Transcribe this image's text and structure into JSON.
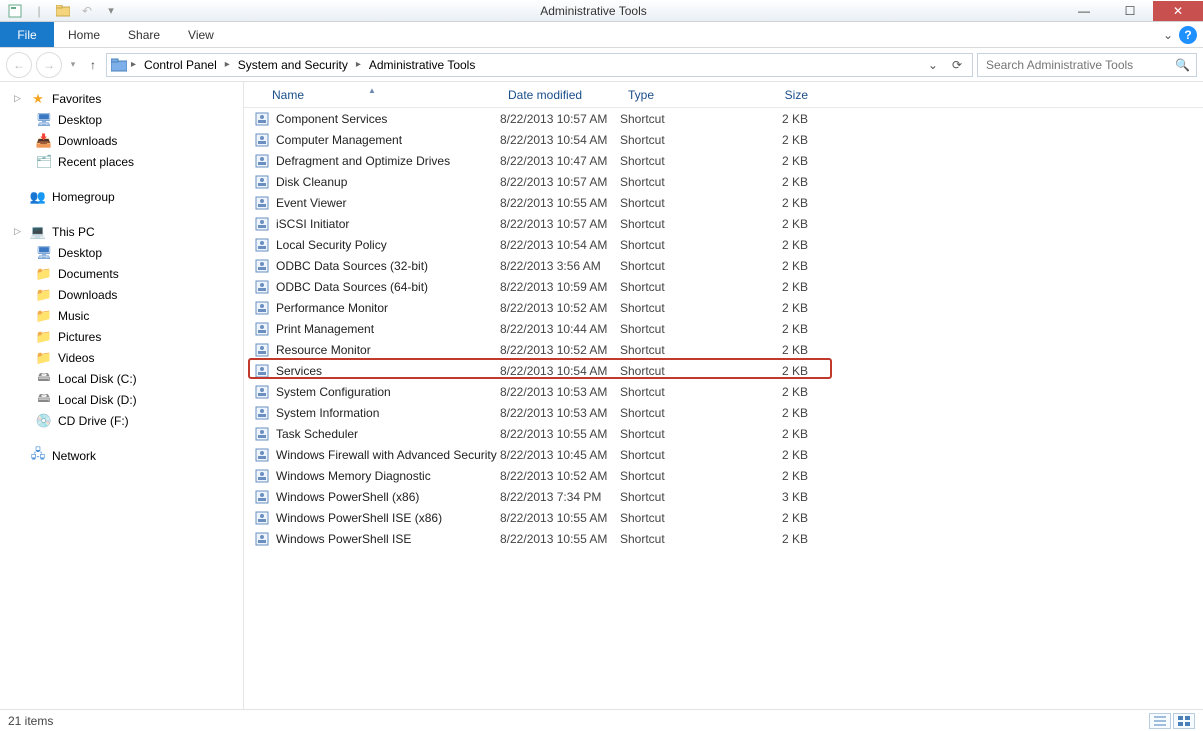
{
  "window": {
    "title": "Administrative Tools"
  },
  "ribbon": {
    "file": "File",
    "tabs": [
      "Home",
      "Share",
      "View"
    ]
  },
  "breadcrumb": [
    "Control Panel",
    "System and Security",
    "Administrative Tools"
  ],
  "search": {
    "placeholder": "Search Administrative Tools"
  },
  "sidebar": {
    "favorites": {
      "label": "Favorites",
      "items": [
        "Desktop",
        "Downloads",
        "Recent places"
      ]
    },
    "homegroup": {
      "label": "Homegroup"
    },
    "thispc": {
      "label": "This PC",
      "items": [
        "Desktop",
        "Documents",
        "Downloads",
        "Music",
        "Pictures",
        "Videos",
        "Local Disk (C:)",
        "Local Disk (D:)",
        "CD Drive (F:)"
      ]
    },
    "network": {
      "label": "Network"
    }
  },
  "columns": {
    "name": "Name",
    "date": "Date modified",
    "type": "Type",
    "size": "Size"
  },
  "files": [
    {
      "name": "Component Services",
      "date": "8/22/2013 10:57 AM",
      "type": "Shortcut",
      "size": "2 KB"
    },
    {
      "name": "Computer Management",
      "date": "8/22/2013 10:54 AM",
      "type": "Shortcut",
      "size": "2 KB"
    },
    {
      "name": "Defragment and Optimize Drives",
      "date": "8/22/2013 10:47 AM",
      "type": "Shortcut",
      "size": "2 KB"
    },
    {
      "name": "Disk Cleanup",
      "date": "8/22/2013 10:57 AM",
      "type": "Shortcut",
      "size": "2 KB"
    },
    {
      "name": "Event Viewer",
      "date": "8/22/2013 10:55 AM",
      "type": "Shortcut",
      "size": "2 KB"
    },
    {
      "name": "iSCSI Initiator",
      "date": "8/22/2013 10:57 AM",
      "type": "Shortcut",
      "size": "2 KB"
    },
    {
      "name": "Local Security Policy",
      "date": "8/22/2013 10:54 AM",
      "type": "Shortcut",
      "size": "2 KB"
    },
    {
      "name": "ODBC Data Sources (32-bit)",
      "date": "8/22/2013 3:56 AM",
      "type": "Shortcut",
      "size": "2 KB"
    },
    {
      "name": "ODBC Data Sources (64-bit)",
      "date": "8/22/2013 10:59 AM",
      "type": "Shortcut",
      "size": "2 KB"
    },
    {
      "name": "Performance Monitor",
      "date": "8/22/2013 10:52 AM",
      "type": "Shortcut",
      "size": "2 KB"
    },
    {
      "name": "Print Management",
      "date": "8/22/2013 10:44 AM",
      "type": "Shortcut",
      "size": "2 KB"
    },
    {
      "name": "Resource Monitor",
      "date": "8/22/2013 10:52 AM",
      "type": "Shortcut",
      "size": "2 KB"
    },
    {
      "name": "Services",
      "date": "8/22/2013 10:54 AM",
      "type": "Shortcut",
      "size": "2 KB",
      "highlight": true
    },
    {
      "name": "System Configuration",
      "date": "8/22/2013 10:53 AM",
      "type": "Shortcut",
      "size": "2 KB"
    },
    {
      "name": "System Information",
      "date": "8/22/2013 10:53 AM",
      "type": "Shortcut",
      "size": "2 KB"
    },
    {
      "name": "Task Scheduler",
      "date": "8/22/2013 10:55 AM",
      "type": "Shortcut",
      "size": "2 KB"
    },
    {
      "name": "Windows Firewall with Advanced Security",
      "date": "8/22/2013 10:45 AM",
      "type": "Shortcut",
      "size": "2 KB"
    },
    {
      "name": "Windows Memory Diagnostic",
      "date": "8/22/2013 10:52 AM",
      "type": "Shortcut",
      "size": "2 KB"
    },
    {
      "name": "Windows PowerShell (x86)",
      "date": "8/22/2013 7:34 PM",
      "type": "Shortcut",
      "size": "3 KB"
    },
    {
      "name": "Windows PowerShell ISE (x86)",
      "date": "8/22/2013 10:55 AM",
      "type": "Shortcut",
      "size": "2 KB"
    },
    {
      "name": "Windows PowerShell ISE",
      "date": "8/22/2013 10:55 AM",
      "type": "Shortcut",
      "size": "2 KB"
    }
  ],
  "status": {
    "count": "21 items"
  }
}
